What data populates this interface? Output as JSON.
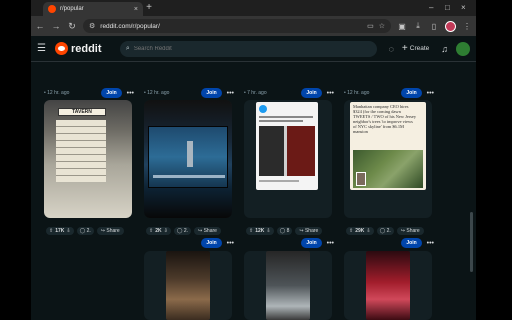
{
  "browser": {
    "tab_title": "r/popular",
    "url": "reddit.com/r/popular/"
  },
  "header": {
    "brand": "reddit",
    "search_placeholder": "Search Reddit",
    "create_label": "Create"
  },
  "posts_top": [
    {
      "time": "• 12 hr. ago",
      "join": "Join",
      "votes": "17K",
      "comments": "2.",
      "share": "Share"
    },
    {
      "time": "• 12 hr. ago",
      "join": "Join",
      "votes": "2K",
      "comments": "2.",
      "share": "Share"
    },
    {
      "time": "• 7 hr. ago",
      "join": "Join",
      "votes": "12K",
      "comments": "8",
      "share": "Share"
    },
    {
      "time": "• 12 hr. ago",
      "join": "Join",
      "votes": "29K",
      "comments": "2.",
      "share": "Share"
    }
  ],
  "posts_bottom": [
    {
      "join": "Join"
    },
    {
      "join": "Join"
    },
    {
      "join": "Join"
    }
  ],
  "thumb_text": {
    "pizza_box": "TAVERN",
    "article_lines": [
      "Manhattan company CEO hires",
      "$324 (for the coming dawn",
      "TWEETS / TWO of his New Jersey",
      "neighbor's trees 'to improve views",
      "of NYC skyline' from $6.1M",
      "mansion"
    ]
  }
}
